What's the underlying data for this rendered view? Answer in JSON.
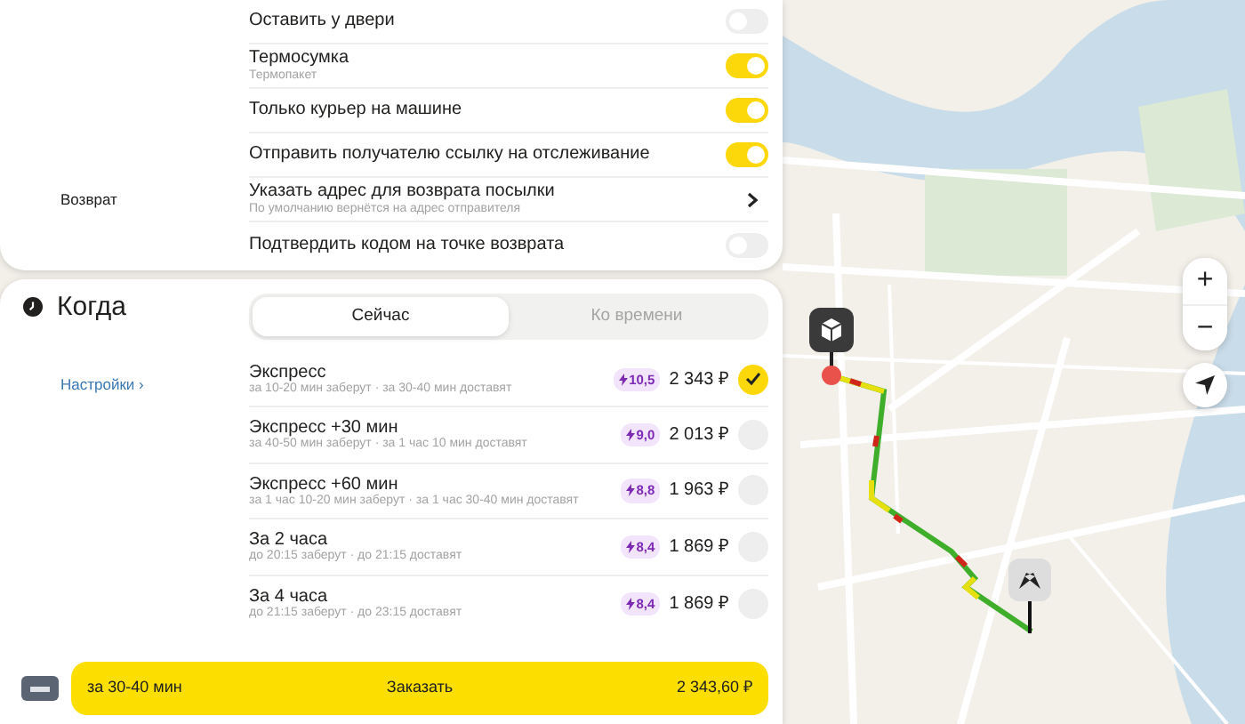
{
  "options_card": {
    "rows": [
      {
        "label": "Оставить у двери",
        "kind": "toggle",
        "on": false
      },
      {
        "label": "Термосумка",
        "sublabel": "Термопакет",
        "kind": "toggle",
        "on": true
      },
      {
        "label": "Только курьер на машине",
        "kind": "toggle",
        "on": true
      },
      {
        "label": "Отправить получателю ссылку на отслеживание",
        "kind": "toggle",
        "on": true
      },
      {
        "section": "Возврат",
        "label": "Указать адрес для возврата посылки",
        "sublabel": "По умолчанию вернётся на адрес отправителя",
        "kind": "link"
      },
      {
        "label": "Подтвердить кодом на точке возврата",
        "kind": "toggle",
        "on": false
      }
    ]
  },
  "when_card": {
    "title": "Когда",
    "tabs": [
      {
        "label": "Сейчас",
        "selected": true
      },
      {
        "label": "Ко времени",
        "selected": false
      }
    ],
    "settings_link": "Настройки ›",
    "tariffs": [
      {
        "name": "Экспресс",
        "detail": "за 10-20 мин заберут · за 30-40 мин доставят",
        "bonus": "10,5",
        "price": "2 343 ₽",
        "selected": true
      },
      {
        "name": "Экспресс +30 мин",
        "detail": "за 40-50 мин заберут · за 1 час 10 мин доставят",
        "bonus": "9,0",
        "price": "2 013 ₽",
        "selected": false
      },
      {
        "name": "Экспресс +60 мин",
        "detail": "за 1 час 10-20 мин заберут · за 1 час 30-40 мин доставят",
        "bonus": "8,8",
        "price": "1 963 ₽",
        "selected": false
      },
      {
        "name": "За 2 часа",
        "detail": "до 20:15 заберут · до 21:15 доставят",
        "bonus": "8,4",
        "price": "1 869 ₽",
        "selected": false
      },
      {
        "name": "За 4 часа",
        "detail": "до 21:15 заберут · до 23:15 доставят",
        "bonus": "8,4",
        "price": "1 869 ₽",
        "selected": false
      }
    ],
    "order_button": {
      "eta": "за 30-40 мин",
      "label": "Заказать",
      "price": "2 343,60 ₽"
    }
  },
  "map": {
    "controls": [
      "+",
      "−"
    ]
  }
}
